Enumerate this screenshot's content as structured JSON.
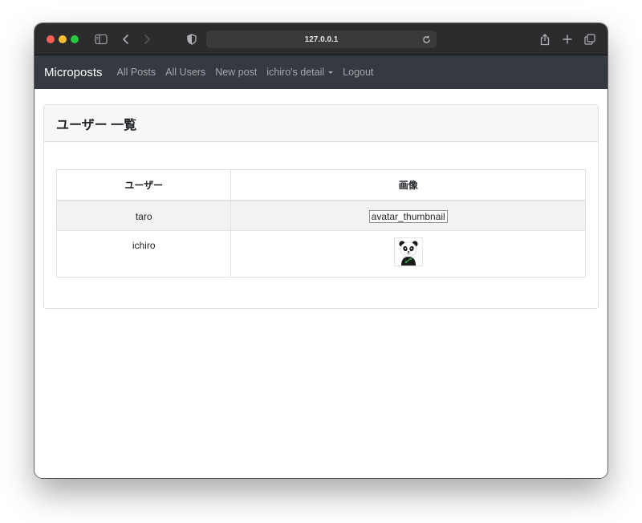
{
  "browser": {
    "url": "127.0.0.1"
  },
  "navbar": {
    "brand": "Microposts",
    "links": [
      "All Posts",
      "All Users",
      "New post",
      "ichiro's detail",
      "Logout"
    ]
  },
  "card": {
    "title": "ユーザー 一覧"
  },
  "table": {
    "headers": [
      "ユーザー",
      "画像"
    ],
    "rows": [
      {
        "name": "taro",
        "image_alt": "avatar_thumbnail"
      },
      {
        "name": "ichiro"
      }
    ]
  },
  "icons": [
    "sidebar-icon",
    "back-icon",
    "forward-icon",
    "shield-icon",
    "reload-icon",
    "share-icon",
    "new-tab-icon",
    "tabs-overview-icon",
    "caret-down-icon",
    "panda-avatar-icon"
  ]
}
